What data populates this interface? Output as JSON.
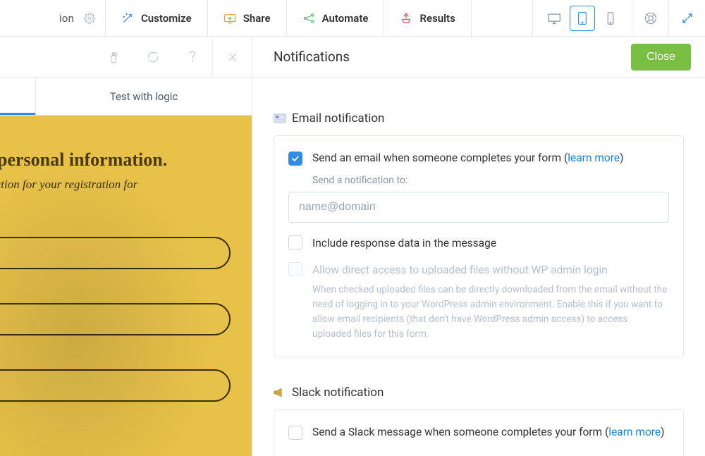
{
  "topbar": {
    "left_fragment": "ion",
    "tabs": {
      "customize": "Customize",
      "share": "Share",
      "automate": "Automate",
      "results": "Results"
    }
  },
  "secondbar": {
    "panel_title": "Notifications",
    "close_label": "Close"
  },
  "left_tabs": {
    "test_with_logic": "Test with logic"
  },
  "preview": {
    "title": "personal information.",
    "subtitle": "al information for your registration for"
  },
  "email_section": {
    "heading": "Email notification",
    "send_email_pre": "Send an email when someone completes your form (",
    "learn_more": "learn more",
    "send_email_post": ")",
    "send_to_label": "Send a notification to:",
    "placeholder": "name@domain",
    "include_response": "Include response data in the message",
    "allow_direct": "Allow direct access to uploaded files without WP admin login",
    "allow_direct_desc": "When checked uploaded files can be directly downloaded from the email without the need of logging in to your WordPress admin environment. Enable this if you want to allow email recipients (that don't have WordPress admin access) to access uploaded files for this form."
  },
  "slack_section": {
    "heading": "Slack notification",
    "send_slack_pre": "Send a Slack message when someone completes your form (",
    "learn_more": "learn more",
    "send_slack_post": ")"
  }
}
